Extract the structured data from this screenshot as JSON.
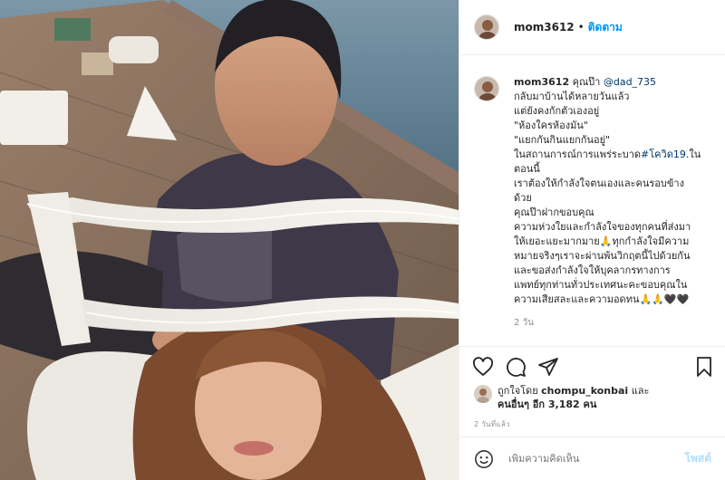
{
  "photo": {
    "alt_icon": "photo-collage"
  },
  "header": {
    "username": "mom3612",
    "separator": "•",
    "follow_label": "ติดตาม"
  },
  "caption": {
    "username": "mom3612",
    "prefix": "คุณป๊า",
    "mention": "@dad_735",
    "lines": [
      "กลับมาบ้านได้หลายวันแล้ว",
      "แต่ยังคงกักตัวเองอยู่",
      "\"ห้องใครห้องมัน\"",
      "\"แยกกันกินแยกกันอยู่\"",
      "ในสถานการณ์การแพร่ระบาด",
      "ตอนนี้",
      "เราต้องให้กำลังใจตนเองและคนรอบข้าง",
      "ด้วย",
      "คุณป๊าฝากขอบคุณ",
      "ความห่วงใยและกำลังใจของทุกคนที่ส่งมา",
      "ให้เยอะแยะมากมาย🙏ทุกกำลังใจมีความ",
      "หมายจริงๆเราจะผ่านพ้นวิกฤตนี้ไปด้วยกัน",
      "และขอส่งกำลังใจให้บุคลากรทางการ",
      "แพทย์ทุกท่านทั่วประเทศนะคะขอบคุณใน",
      "ความเสียสละและความอดทน🙏🙏🖤🖤"
    ],
    "hashtag": "#โควิด19",
    "hashtag_suffix": ".ใน",
    "time": "2 วัน"
  },
  "likes": {
    "prefix": "ถูกใจโดย",
    "user": "chompu_konbai",
    "conj": "และ",
    "others_prefix": "คนอื่นๆ อีก",
    "count": "3,182",
    "unit": "คน"
  },
  "posted": "2 วันที่แล้ว",
  "comment": {
    "placeholder": "เพิ่มความคิดเห็น",
    "post_label": "โพสต์"
  },
  "colors": {
    "link": "#0095f6",
    "post_disabled": "#b2dffc",
    "muted": "#8e8e8e"
  }
}
